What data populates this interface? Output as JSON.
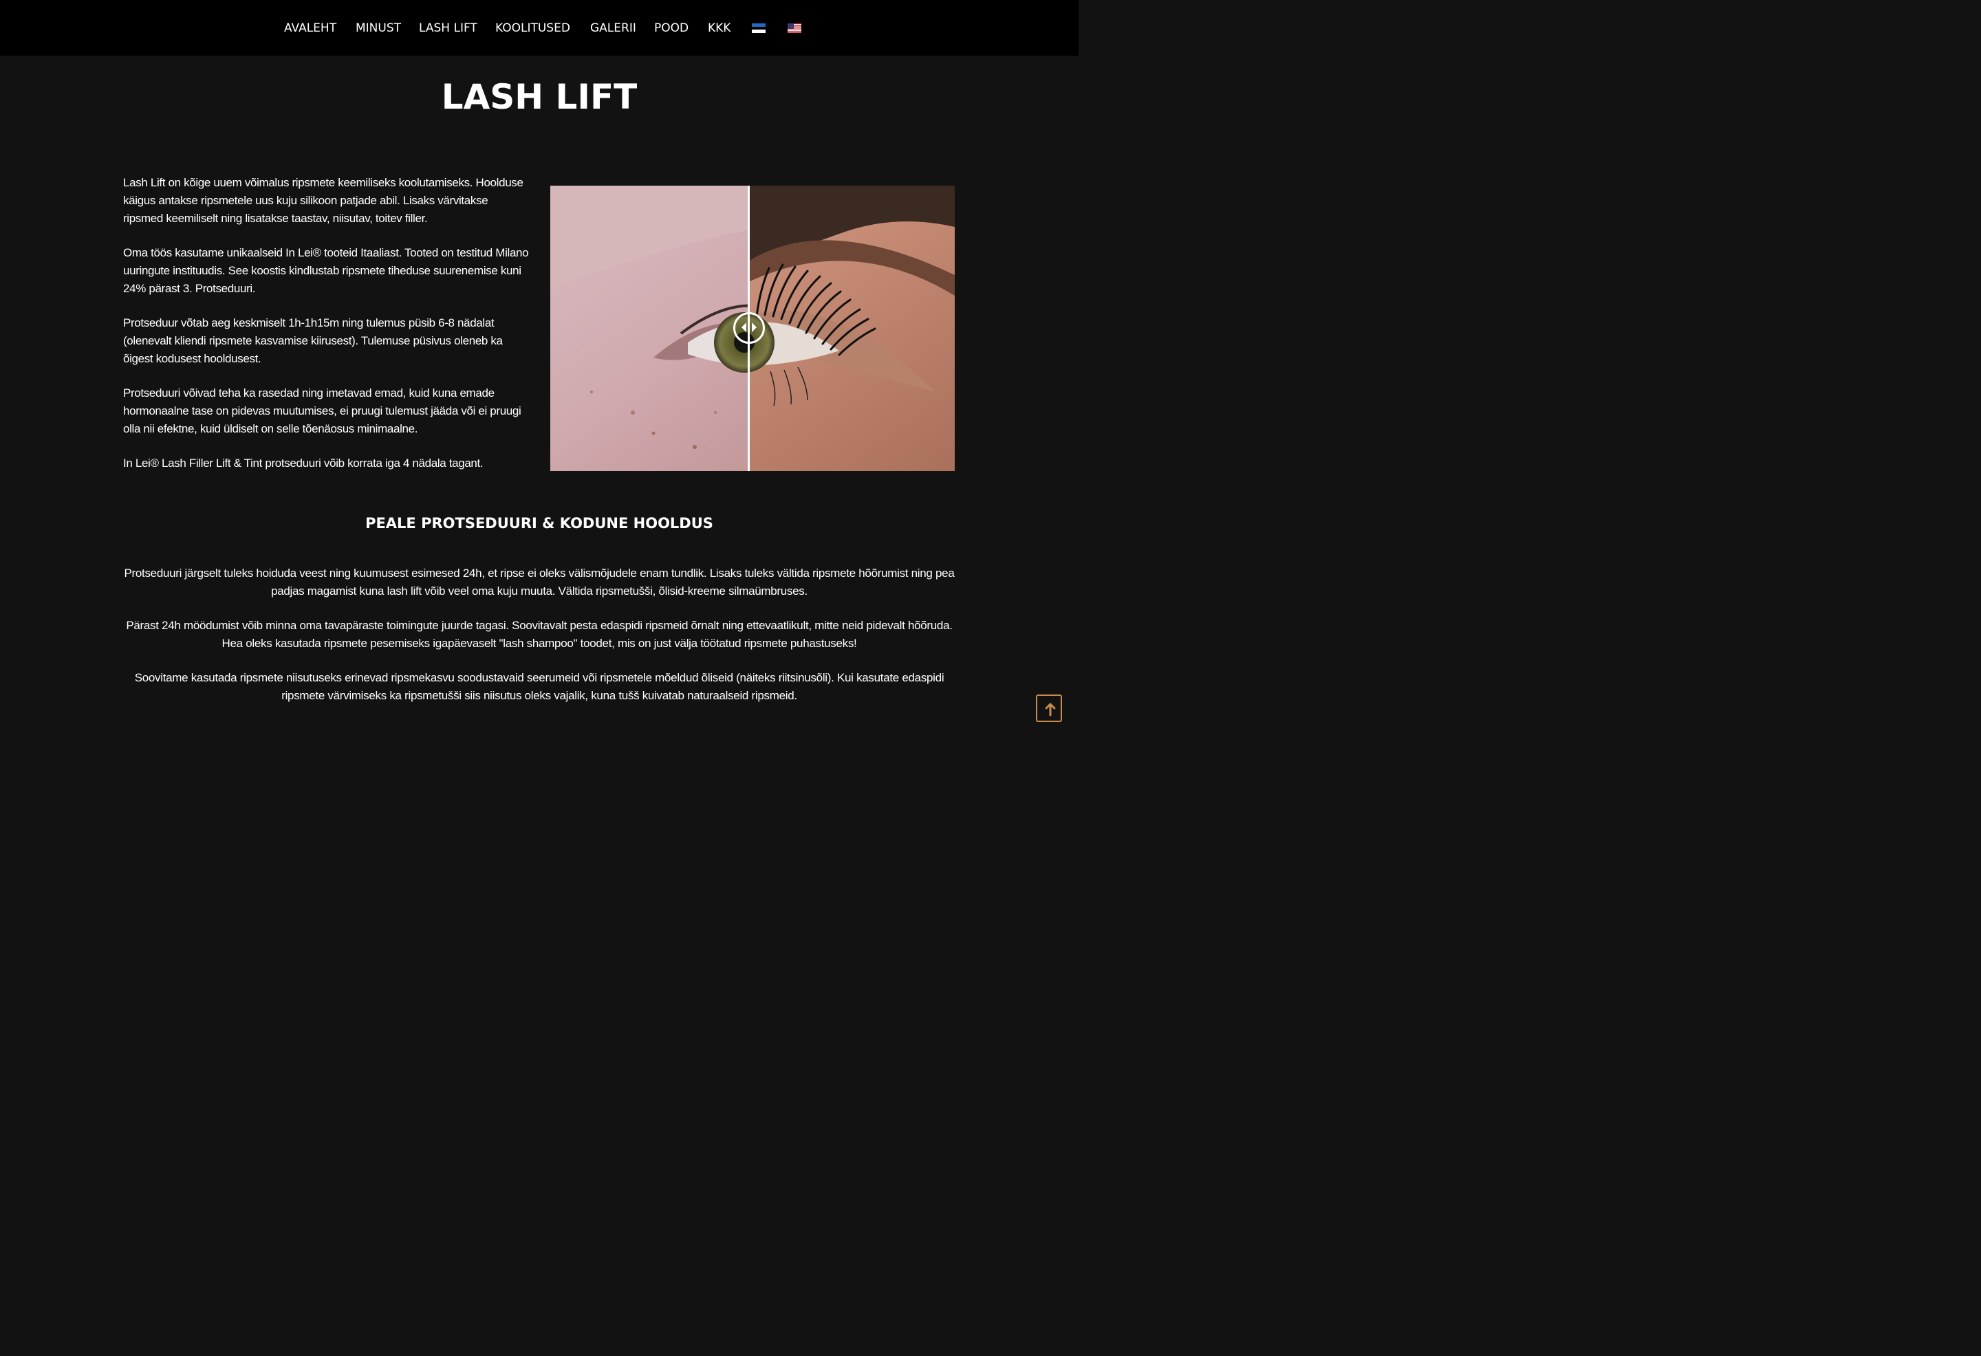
{
  "nav": {
    "items": [
      {
        "label": "AVALEHT"
      },
      {
        "label": "MINUST"
      },
      {
        "label": "LASH LIFT"
      },
      {
        "label": "KOOLITUSED"
      },
      {
        "label": "GALERII"
      },
      {
        "label": "POOD"
      },
      {
        "label": "KKK"
      }
    ],
    "languages": [
      "estonian-flag-icon",
      "us-flag-icon"
    ]
  },
  "page": {
    "title": "LASH LIFT"
  },
  "intro": {
    "paragraphs": [
      "Lash Lift on kõige uuem võimalus ripsmete keemiliseks koolutamiseks. Hoolduse käigus antakse ripsmetele uus kuju silikoon patjade abil. Lisaks värvitakse ripsmed keemiliselt ning lisatakse taastav, niisutav, toitev filler.",
      "Oma töös kasutame unikaalseid In Lei® tooteid Itaaliast. Tooted on testitud Milano uuringute instituudis. See koostis kindlustab ripsmete tiheduse suurenemise kuni 24% pärast 3. Protseduuri.",
      "Protseduur võtab aeg keskmiselt 1h-1h15m ning tulemus püsib 6-8 nädalat (olenevalt kliendi ripsmete kasvamise kiirusest). Tulemuse püsivus oleneb ka õigest kodusest hooldusest.",
      "Protseduuri võivad teha ka rasedad ning imetavad emad, kuid kuna emade hormonaalne tase on pidevas muutumises, ei pruugi tulemust jääda või ei pruugi olla nii efektne, kuid üldiselt on selle tõenäosus minimaalne.",
      "In Lei® Lash Filler Lift & Tint protseduuri võib korrata iga 4 nädala tagant."
    ]
  },
  "comparison": {
    "slider_position": 0.49
  },
  "aftercare": {
    "heading": "PEALE PROTSEDUURI & KODUNE HOOLDUS",
    "paragraphs": [
      "Protseduuri järgselt tuleks hoiduda veest ning kuumusest esimesed 24h, et ripse ei oleks välismõjudele enam tundlik. Lisaks tuleks vältida ripsmete hõõrumist ning pea padjas magamist kuna lash lift võib veel oma kuju muuta. Vältida ripsmetušši, õlisid-kreeme silmaümbruses.",
      "Pärast 24h möödumist võib minna oma tavapäraste toimingute juurde tagasi. Soovitavalt pesta edaspidi ripsmeid õrnalt ning ettevaatlikult, mitte neid pidevalt hõõruda. Hea oleks kasutada ripsmete pesemiseks igapäevaselt \"lash shampoo\" toodet, mis on just välja töötatud ripsmete puhastuseks!",
      "Soovitame kasutada ripsmete niisutuseks erinevad ripsmekasvu soodustavaid seerumeid või ripsmetele mõeldud õliseid (näiteks riitsinusõli). Kui kasutate edaspidi ripsmete värvimiseks ka ripsmetušši siis niisutus oleks vajalik, kuna tušš kuivatab naturaalseid ripsmeid."
    ]
  },
  "colors": {
    "background": "#121212",
    "nav_background": "#000000",
    "text": "#ffffff",
    "scroll_button_border": "#c98a4a"
  },
  "scroll_top": {
    "icon": "arrow-up-icon"
  }
}
